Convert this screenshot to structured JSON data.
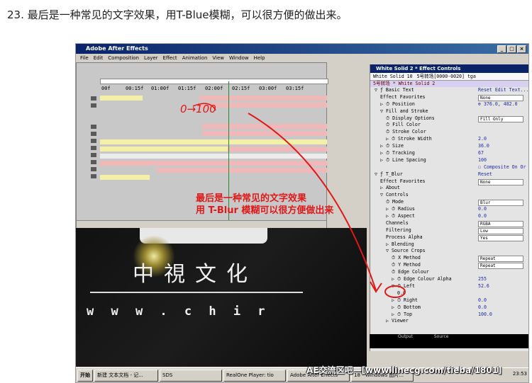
{
  "heading": "23. 最后是一种常见的文字效果，用T-Blue模糊，可以很方便的做出来。",
  "window": {
    "title": "Adobe After Effects",
    "controls": [
      "_",
      "□",
      "×"
    ]
  },
  "menu": [
    "File",
    "Edit",
    "Composition",
    "Layer",
    "Effect",
    "Animation",
    "View",
    "Window",
    "Help"
  ],
  "timeline": {
    "ruler": [
      "00f",
      "00:15f",
      "01:00f",
      "01:15f",
      "02:00f",
      "02:15f",
      "03:00f",
      "03:15f"
    ],
    "handwritten": "0→100"
  },
  "comp": {
    "logo_text": "中視文化",
    "url_text": "w w w . c h i r"
  },
  "effect_controls": {
    "title": "White Solid 2 * Effect Controls",
    "tabs": [
      "White Solid 10",
      "5号转场[0000-0020] tga"
    ],
    "subheader": "5号转场 * White Solid 2",
    "rows": [
      {
        "n": "▽ ƒ Basic Text",
        "v": "Reset Edit Text...",
        "i": 0
      },
      {
        "n": "Effect Favorites",
        "v": "None",
        "i": 1,
        "box": true
      },
      {
        "n": "▷ ⏱ Position",
        "v": "⊕ 376.0, 482.0",
        "i": 1
      },
      {
        "n": "▽ Fill and Stroke",
        "v": "",
        "i": 1
      },
      {
        "n": "⏱ Display Options",
        "v": "Fill Only",
        "i": 2,
        "box": true
      },
      {
        "n": "⏱ Fill Color",
        "v": "",
        "i": 2
      },
      {
        "n": "⏱ Stroke Color",
        "v": "",
        "i": 2
      },
      {
        "n": "▷ ⏱ Stroke Width",
        "v": "2.0",
        "i": 2
      },
      {
        "n": "▷ ⏱ Size",
        "v": "36.0",
        "i": 1
      },
      {
        "n": "▷ ⏱ Tracking",
        "v": "67",
        "i": 1
      },
      {
        "n": "▷ ⏱ Line Spacing",
        "v": "100",
        "i": 1
      },
      {
        "n": "",
        "v": "☐ Composite On Or",
        "i": 1
      },
      {
        "n": "▽ ƒ T_Blur",
        "v": "Reset",
        "i": 0
      },
      {
        "n": "Effect Favorites",
        "v": "None",
        "i": 1,
        "box": true
      },
      {
        "n": "▷ About",
        "v": "",
        "i": 1
      },
      {
        "n": "▽ Controls",
        "v": "",
        "i": 1
      },
      {
        "n": "⏱ Mode",
        "v": "Blur",
        "i": 2,
        "box": true
      },
      {
        "n": "▷ ⏱ Radius",
        "v": "0.0",
        "i": 2
      },
      {
        "n": "▷ ⏱ Aspect",
        "v": "0.0",
        "i": 2
      },
      {
        "n": "Channels",
        "v": "RGBA",
        "i": 2,
        "box": true
      },
      {
        "n": "Filtering",
        "v": "Low",
        "i": 2,
        "box": true
      },
      {
        "n": "Process Alpha",
        "v": "Yes",
        "i": 2,
        "box": true
      },
      {
        "n": "▷ Blending",
        "v": "",
        "i": 2
      },
      {
        "n": "▽ Source Crops",
        "v": "",
        "i": 2
      },
      {
        "n": "⏱ X Method",
        "v": "Repeat",
        "i": 3,
        "box": true
      },
      {
        "n": "⏱ Y Method",
        "v": "Repeat",
        "i": 3,
        "box": true
      },
      {
        "n": "⏱ Edge Colour",
        "v": "",
        "i": 3
      },
      {
        "n": "▷ ⏱ Edge Colour Alpha",
        "v": "255",
        "i": 3
      },
      {
        "n": "▽ ⏱ Left",
        "v": "52.6",
        "i": 3
      },
      {
        "n": "0.0",
        "v": "",
        "i": 4
      },
      {
        "n": "▷ ⏱ Right",
        "v": "0.0",
        "i": 3
      },
      {
        "n": "▷ ⏱ Bottom",
        "v": "0.0",
        "i": 3
      },
      {
        "n": "▷ ⏱ Top",
        "v": "100.0",
        "i": 3
      },
      {
        "n": "▷ Viewer",
        "v": "",
        "i": 2
      }
    ],
    "footer_tabs": [
      "Output",
      "Source"
    ]
  },
  "annotation": [
    "最后是一种常见的文字效果",
    "用 T-Blur 模糊可以很方便做出来"
  ],
  "taskbar": {
    "start": "开始",
    "items": [
      "新建 文本文档 - 记...",
      "SDS",
      "RealOne Player: tio",
      "Adobe After Effects",
      "18 - Windows 图片..."
    ],
    "clock": "23:53"
  },
  "watermark": "AE交流区吧—[www.linecg.com/tieba/1801]",
  "colors": {
    "annotation_red": "#e01818",
    "track_pink": "#f0b8b8",
    "track_yellow": "#f4f0a8"
  }
}
